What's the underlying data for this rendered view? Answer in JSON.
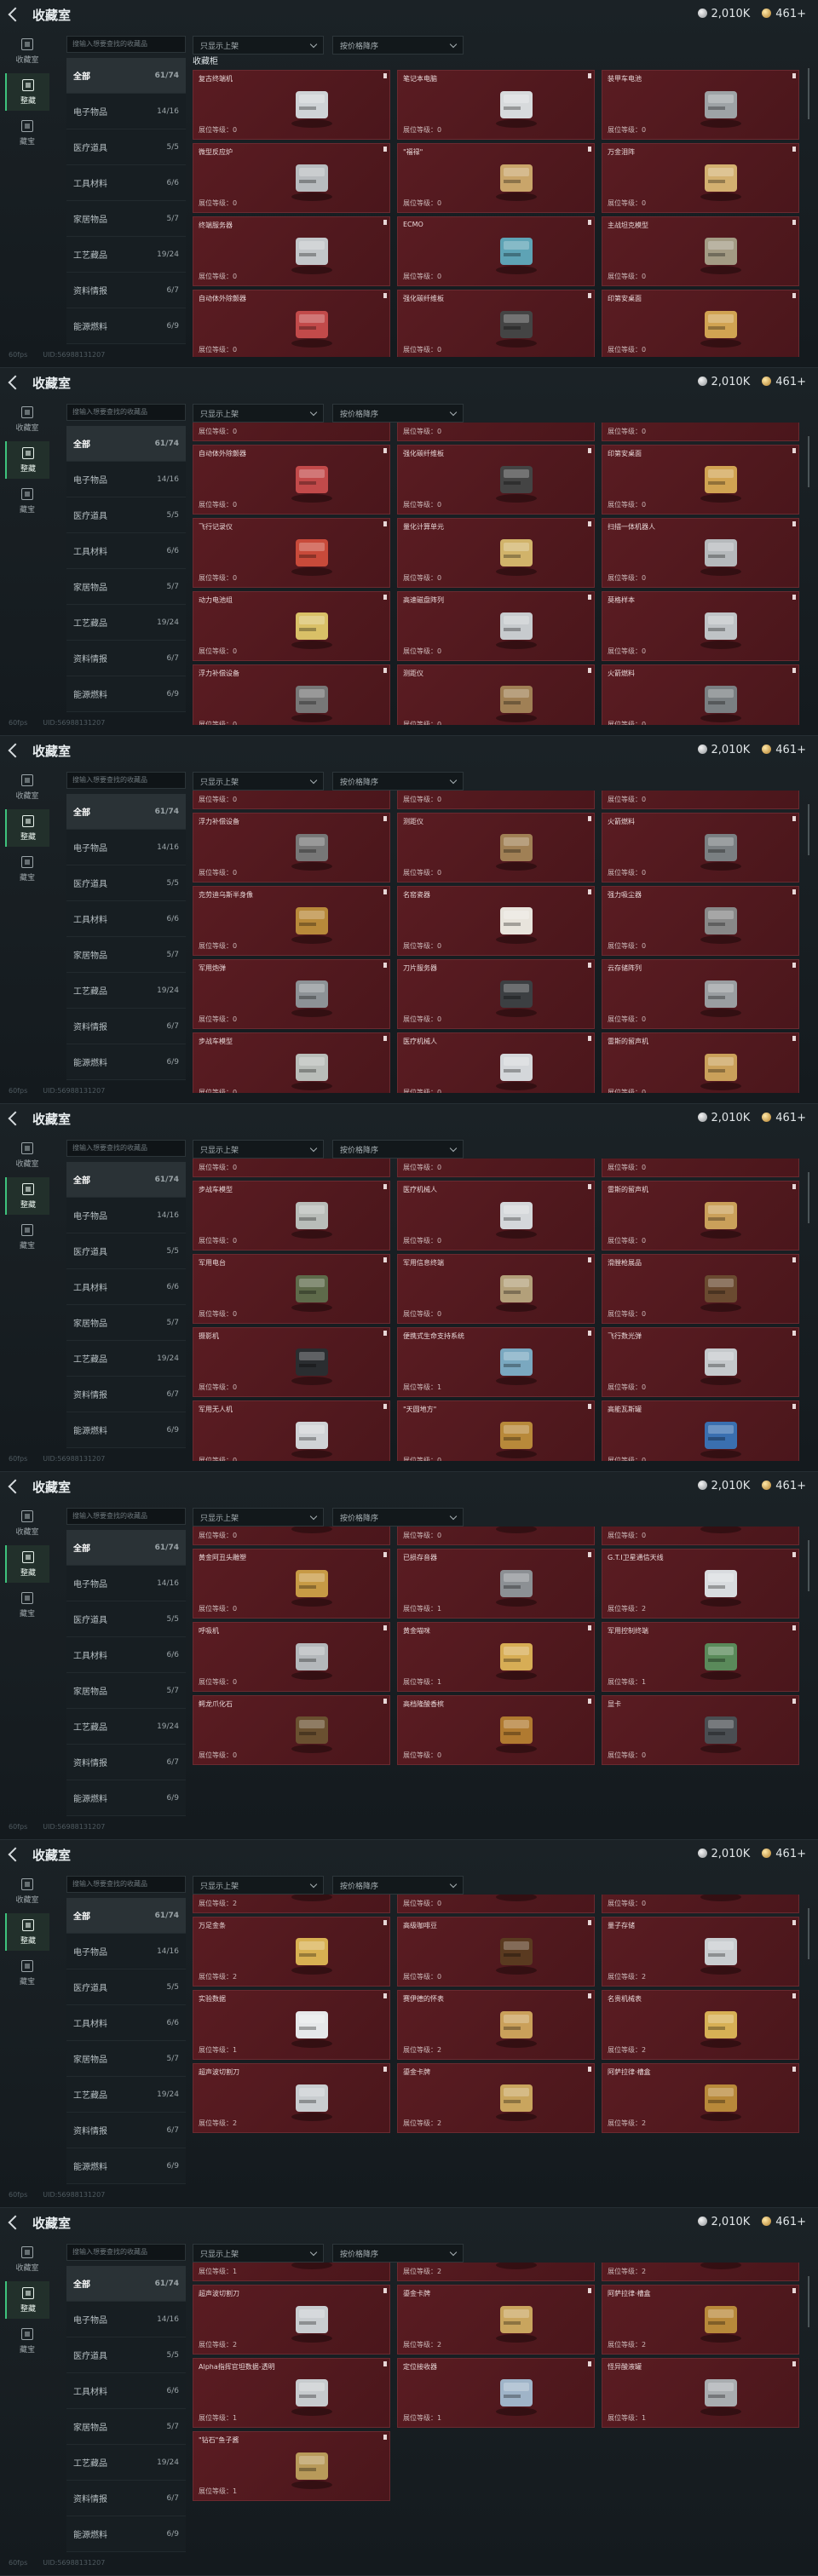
{
  "header": {
    "title": "收藏室",
    "currency": [
      {
        "icon": "silver-coin-icon",
        "value": "2,010K"
      },
      {
        "icon": "gold-coin-icon",
        "value": "461+"
      }
    ]
  },
  "rail": [
    {
      "label": "收藏室"
    },
    {
      "label": "整藏"
    },
    {
      "label": "藏宝"
    }
  ],
  "search": {
    "placeholder": "搜输入想要查找的收藏品"
  },
  "categories": [
    {
      "label": "全部",
      "count": "61/74"
    },
    {
      "label": "电子物品",
      "count": "14/16"
    },
    {
      "label": "医疗道具",
      "count": "5/5"
    },
    {
      "label": "工具材料",
      "count": "6/6"
    },
    {
      "label": "家居物品",
      "count": "5/7"
    },
    {
      "label": "工艺藏品",
      "count": "19/24"
    },
    {
      "label": "资料情报",
      "count": "6/7"
    },
    {
      "label": "能源燃料",
      "count": "6/9"
    }
  ],
  "filters": {
    "display": "只显示上架",
    "sort": "按价格降序"
  },
  "footer": {
    "fps": "60fps",
    "uid": "UID:56988131207"
  },
  "level_prefix": "展位等级：",
  "panels": [
    {
      "section": "收藏柜",
      "cards": [
        {
          "name": "复古终端机",
          "lv": "0",
          "icon": "terminal-icon",
          "c": "#cfd3d6"
        },
        {
          "name": "笔记本电脑",
          "lv": "0",
          "icon": "laptop-icon",
          "c": "#d7dadc"
        },
        {
          "name": "装甲车电池",
          "lv": "0",
          "icon": "battery-icon",
          "c": "#9ea3a6"
        },
        {
          "name": "微型反应炉",
          "lv": "0",
          "icon": "reactor-icon",
          "c": "#b8bcbf"
        },
        {
          "name": "\"福禄\"",
          "lv": "0",
          "icon": "chess-icon",
          "c": "#c9a56a"
        },
        {
          "name": "万金泪阵",
          "lv": "0",
          "icon": "gold-box-icon",
          "c": "#d3b070"
        },
        {
          "name": "终端服务器",
          "lv": "0",
          "icon": "tablet-icon",
          "c": "#c3c7ca"
        },
        {
          "name": "ECMO",
          "lv": "0",
          "icon": "machine-icon",
          "c": "#5ea3b5"
        },
        {
          "name": "主战坦克模型",
          "lv": "0",
          "icon": "tank-icon",
          "c": "#a39b84"
        },
        {
          "name": "自动体外除颤器",
          "lv": "0",
          "icon": "defib-icon",
          "c": "#c24a4a"
        },
        {
          "name": "强化碳纤维板",
          "lv": "0",
          "icon": "plate-icon",
          "c": "#444"
        },
        {
          "name": "印第安桌面",
          "lv": "0",
          "icon": "frame-icon",
          "c": "#d1a352"
        }
      ]
    },
    {
      "section": "",
      "cards": [
        {
          "name": "",
          "lv": "0",
          "icon": "",
          "c": ""
        },
        {
          "name": "",
          "lv": "0",
          "icon": "",
          "c": ""
        },
        {
          "name": "",
          "lv": "0",
          "icon": "",
          "c": ""
        },
        {
          "name": "自动体外除颤器",
          "lv": "0",
          "icon": "defib-icon",
          "c": "#c24a4a"
        },
        {
          "name": "强化碳纤维板",
          "lv": "0",
          "icon": "plate-icon",
          "c": "#444"
        },
        {
          "name": "印第安桌面",
          "lv": "0",
          "icon": "frame-icon",
          "c": "#d1a352"
        },
        {
          "name": "飞行记录仪",
          "lv": "0",
          "icon": "recorder-icon",
          "c": "#c84a3a"
        },
        {
          "name": "量化计算单元",
          "lv": "0",
          "icon": "chip-icon",
          "c": "#d1b36a"
        },
        {
          "name": "扫描一体机器人",
          "lv": "0",
          "icon": "scanner-icon",
          "c": "#b6b9bc"
        },
        {
          "name": "动力电池组",
          "lv": "0",
          "icon": "solar-icon",
          "c": "#d9c067"
        },
        {
          "name": "高速磁盘阵列",
          "lv": "0",
          "icon": "drive-icon",
          "c": "#c7cbce"
        },
        {
          "name": "莫格样本",
          "lv": "0",
          "icon": "tube-icon",
          "c": "#bfc3c6"
        },
        {
          "name": "浮力补偿设备",
          "lv": "0",
          "icon": "buoy-icon",
          "c": "#777"
        },
        {
          "name": "测距仪",
          "lv": "0",
          "icon": "tripod-icon",
          "c": "#a08055"
        },
        {
          "name": "火箭燃料",
          "lv": "0",
          "icon": "canister-icon",
          "c": "#7a7f82"
        }
      ]
    },
    {
      "section": "",
      "cards": [
        {
          "name": "",
          "lv": "0",
          "icon": "",
          "c": ""
        },
        {
          "name": "",
          "lv": "0",
          "icon": "",
          "c": ""
        },
        {
          "name": "",
          "lv": "0",
          "icon": "",
          "c": ""
        },
        {
          "name": "浮力补偿设备",
          "lv": "0",
          "icon": "buoy-icon",
          "c": "#777"
        },
        {
          "name": "测距仪",
          "lv": "0",
          "icon": "tripod-icon",
          "c": "#a08055"
        },
        {
          "name": "火箭燃料",
          "lv": "0",
          "icon": "canister-icon",
          "c": "#7a7f82"
        },
        {
          "name": "克劳迪乌斯半身像",
          "lv": "0",
          "icon": "bust-icon",
          "c": "#b8893a"
        },
        {
          "name": "名窑瓷器",
          "lv": "0",
          "icon": "vase-icon",
          "c": "#e8e4dc"
        },
        {
          "name": "强力吸尘器",
          "lv": "0",
          "icon": "vacuum-icon",
          "c": "#888"
        },
        {
          "name": "军用炮弹",
          "lv": "0",
          "icon": "shell-icon",
          "c": "#8d9296"
        },
        {
          "name": "刀片服务器",
          "lv": "0",
          "icon": "server-icon",
          "c": "#3c3f42"
        },
        {
          "name": "云存储阵列",
          "lv": "0",
          "icon": "storage-icon",
          "c": "#9a9ea1"
        },
        {
          "name": "步战车模型",
          "lv": "0",
          "icon": "ifv-icon",
          "c": "#b9bdb9"
        },
        {
          "name": "医疗机械人",
          "lv": "0",
          "icon": "robot-icon",
          "c": "#d4d7da"
        },
        {
          "name": "雷斯的留声机",
          "lv": "0",
          "icon": "gramophone-icon",
          "c": "#caa05a"
        }
      ]
    },
    {
      "section": "",
      "cards": [
        {
          "name": "",
          "lv": "0",
          "icon": "",
          "c": ""
        },
        {
          "name": "",
          "lv": "0",
          "icon": "",
          "c": ""
        },
        {
          "name": "",
          "lv": "0",
          "icon": "",
          "c": ""
        },
        {
          "name": "步战车模型",
          "lv": "0",
          "icon": "ifv-icon",
          "c": "#b9bdb9"
        },
        {
          "name": "医疗机械人",
          "lv": "0",
          "icon": "robot-icon",
          "c": "#d4d7da"
        },
        {
          "name": "雷斯的留声机",
          "lv": "0",
          "icon": "gramophone-icon",
          "c": "#caa05a"
        },
        {
          "name": "军用电台",
          "lv": "0",
          "icon": "radio-icon",
          "c": "#5e6a4a"
        },
        {
          "name": "军用信息终端",
          "lv": "0",
          "icon": "case-icon",
          "c": "#b3a07a"
        },
        {
          "name": "滑膛枪展品",
          "lv": "0",
          "icon": "musket-icon",
          "c": "#6a4a30"
        },
        {
          "name": "摄影机",
          "lv": "0",
          "icon": "camera-icon",
          "c": "#2a2d30"
        },
        {
          "name": "便携式生命支持系统",
          "lv": "1",
          "icon": "lifesupport-icon",
          "c": "#7aa8c0"
        },
        {
          "name": "飞行数光弹",
          "lv": "0",
          "icon": "missile-icon",
          "c": "#c5c9cc"
        },
        {
          "name": "军用无人机",
          "lv": "0",
          "icon": "drone-icon",
          "c": "#d0d3d6"
        },
        {
          "name": "\"天圆地方\"",
          "lv": "0",
          "icon": "globe-icon",
          "c": "#b8893a"
        },
        {
          "name": "高能瓦斯罐",
          "lv": "0",
          "icon": "gas-icon",
          "c": "#3a6fb0"
        }
      ]
    },
    {
      "section": "",
      "cards": [
        {
          "name": "军用无人机",
          "lv": "0",
          "icon": "drone-icon",
          "c": "#d0d3d6"
        },
        {
          "name": "\"天圆地方\"",
          "lv": "0",
          "icon": "globe-icon",
          "c": "#b8893a"
        },
        {
          "name": "高能瓦斯罐",
          "lv": "0",
          "icon": "gas-icon",
          "c": "#3a6fb0"
        },
        {
          "name": "黄金阿丑头雕塑",
          "lv": "0",
          "icon": "statue-icon",
          "c": "#c79a45"
        },
        {
          "name": "已损存音器",
          "lv": "1",
          "icon": "reel-icon",
          "c": "#8c9094"
        },
        {
          "name": "G.T.I卫星通信天线",
          "lv": "2",
          "icon": "dish-icon",
          "c": "#d9dcdf"
        },
        {
          "name": "呼吸机",
          "lv": "0",
          "icon": "ventilator-icon",
          "c": "#b4b8bb"
        },
        {
          "name": "黄金喵咪",
          "lv": "1",
          "icon": "cat-icon",
          "c": "#d7ad55"
        },
        {
          "name": "军用控制终端",
          "lv": "1",
          "icon": "console-icon",
          "c": "#5a8a5a"
        },
        {
          "name": "鳄龙爪化石",
          "lv": "0",
          "icon": "claw-icon",
          "c": "#6a5030"
        },
        {
          "name": "高档隆酸香槟",
          "lv": "0",
          "icon": "bottle-icon",
          "c": "#b07a30"
        },
        {
          "name": "显卡",
          "lv": "0",
          "icon": "gpu-icon",
          "c": "#4a4e52"
        }
      ]
    },
    {
      "section": "",
      "cards": [
        {
          "name": "鳄龙爪化石",
          "lv": "2",
          "icon": "claw-icon",
          "c": "#6a5030"
        },
        {
          "name": "高档隆酸香槟",
          "lv": "0",
          "icon": "bottle-icon",
          "c": "#b07a30"
        },
        {
          "name": "显卡",
          "lv": "0",
          "icon": "gpu-icon",
          "c": "#4a4e52"
        },
        {
          "name": "万足金条",
          "lv": "2",
          "icon": "goldbar-icon",
          "c": "#d8b052"
        },
        {
          "name": "高级咖啡豆",
          "lv": "0",
          "icon": "beans-icon",
          "c": "#5a3a20"
        },
        {
          "name": "量子存储",
          "lv": "2",
          "icon": "usb-icon",
          "c": "#c9cdd0"
        },
        {
          "name": "实验数据",
          "lv": "1",
          "icon": "disc-icon",
          "c": "#e6e8ea"
        },
        {
          "name": "赛伊德的怀表",
          "lv": "2",
          "icon": "watch-icon",
          "c": "#caa05a"
        },
        {
          "name": "名贵机械表",
          "lv": "2",
          "icon": "wristwatch-icon",
          "c": "#d7b055"
        },
        {
          "name": "超声波切割刀",
          "lv": "2",
          "icon": "scalpel-icon",
          "c": "#c9cdd0"
        },
        {
          "name": "鎏金卡牌",
          "lv": "2",
          "icon": "cards-icon",
          "c": "#c9a55e"
        },
        {
          "name": "阿萨拉律·槽盒",
          "lv": "2",
          "icon": "relic-icon",
          "c": "#b8893a"
        }
      ]
    },
    {
      "section": "",
      "cards": [
        {
          "name": "",
          "lv": "1",
          "icon": "disc-icon",
          "c": "#e6e8ea"
        },
        {
          "name": "",
          "lv": "2",
          "icon": "watch-icon",
          "c": "#caa05a"
        },
        {
          "name": "",
          "lv": "2",
          "icon": "wristwatch-icon",
          "c": "#d7b055"
        },
        {
          "name": "超声波切割刀",
          "lv": "2",
          "icon": "scalpel-icon",
          "c": "#c9cdd0"
        },
        {
          "name": "鎏金卡牌",
          "lv": "2",
          "icon": "cards-icon",
          "c": "#c9a55e"
        },
        {
          "name": "阿萨拉律·槽盒",
          "lv": "2",
          "icon": "relic-icon",
          "c": "#b8893a"
        },
        {
          "name": "Alpha指挥官坦数据-透明",
          "lv": "1",
          "icon": "datapad-icon",
          "c": "#c7cbce"
        },
        {
          "name": "定位接收器",
          "lv": "1",
          "icon": "receiver-icon",
          "c": "#9fb4c8"
        },
        {
          "name": "怪异酸液罐",
          "lv": "1",
          "icon": "tank-jar-icon",
          "c": "#a9adb0"
        },
        {
          "name": "\"钻石\"鱼子酱",
          "lv": "1",
          "icon": "caviar-icon",
          "c": "#b89a5a"
        }
      ]
    }
  ]
}
